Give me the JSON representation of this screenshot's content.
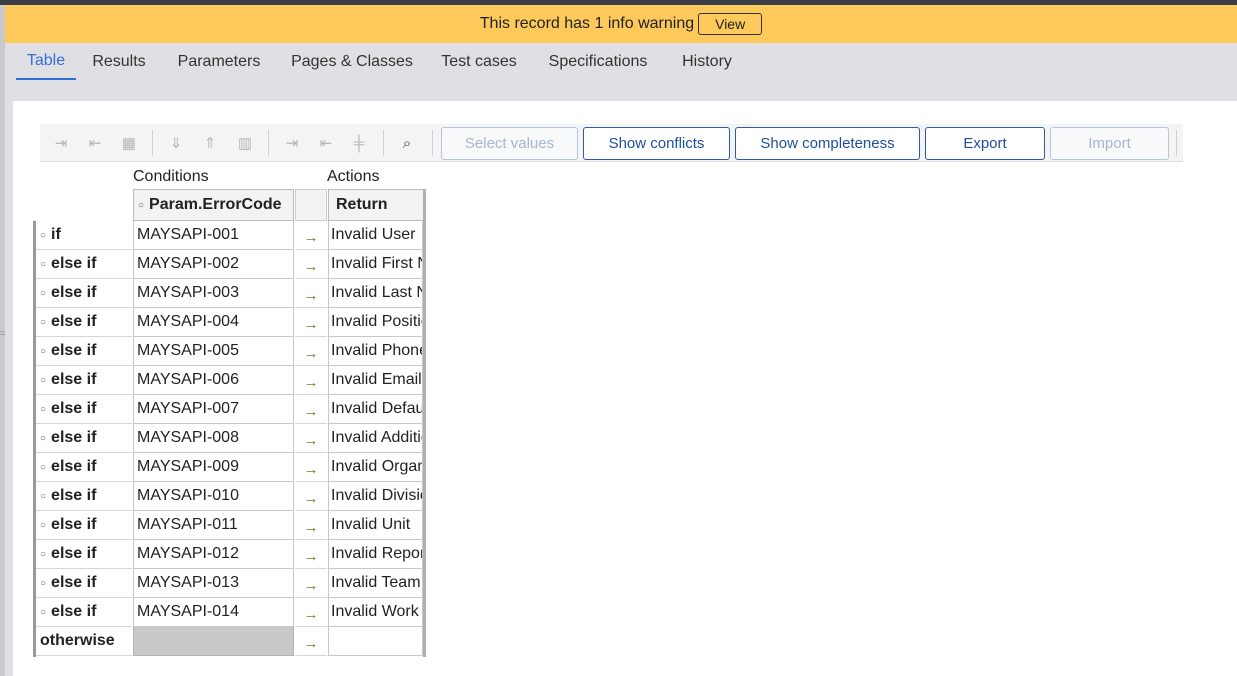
{
  "warning": {
    "message": "This record has 1 info warning",
    "view_label": "View"
  },
  "tabs": [
    {
      "label": "Table",
      "active": true
    },
    {
      "label": "Results"
    },
    {
      "label": "Parameters"
    },
    {
      "label": "Pages & Classes"
    },
    {
      "label": "Test cases"
    },
    {
      "label": "Specifications"
    },
    {
      "label": "History"
    }
  ],
  "toolbar": {
    "icons": [
      "insert-row-after-icon",
      "insert-row-before-icon",
      "delete-row-icon",
      "insert-column-after-icon",
      "insert-column-before-icon",
      "delete-column-icon",
      "insert-action-after-icon",
      "insert-action-before-icon",
      "delete-action-icon",
      "property-lookup-icon"
    ],
    "buttons": {
      "select_values": "Select values",
      "show_conflicts": "Show conflicts",
      "show_completeness": "Show completeness",
      "export": "Export",
      "import": "Import"
    }
  },
  "table": {
    "conditions_label": "Conditions",
    "actions_label": "Actions",
    "condition_header": "Param.ErrorCode",
    "action_header": "Return",
    "rows": [
      {
        "label": "if",
        "condition": "MAYSAPI-001",
        "action": "Invalid User"
      },
      {
        "label": "else if",
        "condition": "MAYSAPI-002",
        "action": "Invalid First Name"
      },
      {
        "label": "else if",
        "condition": "MAYSAPI-003",
        "action": "Invalid Last Name"
      },
      {
        "label": "else if",
        "condition": "MAYSAPI-004",
        "action": "Invalid Position"
      },
      {
        "label": "else if",
        "condition": "MAYSAPI-005",
        "action": "Invalid Phone"
      },
      {
        "label": "else if",
        "condition": "MAYSAPI-006",
        "action": "Invalid Email"
      },
      {
        "label": "else if",
        "condition": "MAYSAPI-007",
        "action": "Invalid Default"
      },
      {
        "label": "else if",
        "condition": "MAYSAPI-008",
        "action": "Invalid Additional"
      },
      {
        "label": "else if",
        "condition": "MAYSAPI-009",
        "action": "Invalid Organization"
      },
      {
        "label": "else if",
        "condition": "MAYSAPI-010",
        "action": "Invalid Division"
      },
      {
        "label": "else if",
        "condition": "MAYSAPI-011",
        "action": "Invalid Unit"
      },
      {
        "label": "else if",
        "condition": "MAYSAPI-012",
        "action": "Invalid Reports To"
      },
      {
        "label": "else if",
        "condition": "MAYSAPI-013",
        "action": "Invalid Team"
      },
      {
        "label": "else if",
        "condition": "MAYSAPI-014",
        "action": "Invalid Work"
      },
      {
        "label": "otherwise",
        "condition": "",
        "action": ""
      }
    ],
    "arrow_glyph": "→"
  },
  "colors": {
    "warning_bg": "#fdc95a",
    "accent": "#2f6fd6",
    "button_border": "#2c5da8",
    "arrow": "#5d8a2a"
  }
}
